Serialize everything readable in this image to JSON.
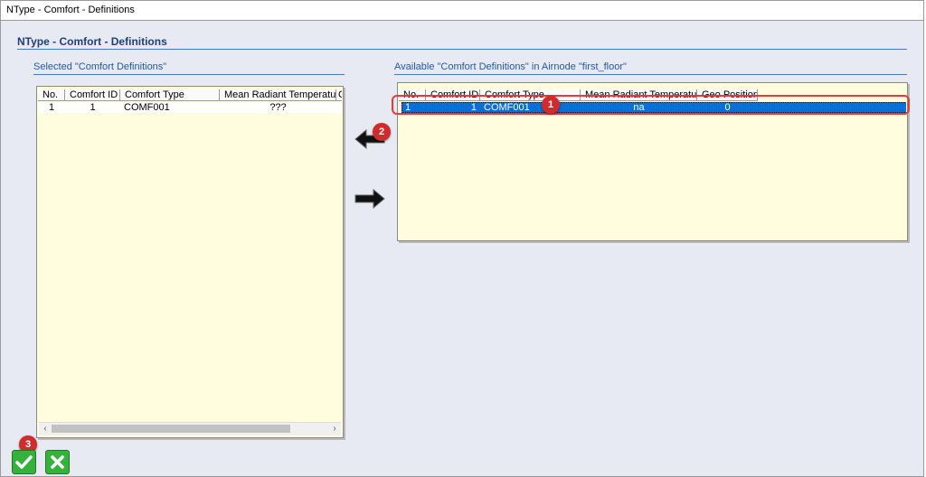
{
  "window": {
    "title": "NType - Comfort - Definitions"
  },
  "header": {
    "title": "NType - Comfort - Definitions"
  },
  "left_panel": {
    "title": "Selected \"Comfort Definitions\"",
    "columns": [
      "No.",
      "Comfort ID",
      "Comfort Type",
      "Mean Radiant Temperature",
      "G"
    ],
    "rows": [
      {
        "no": "1",
        "comfort_id": "1",
        "comfort_type": "COMF001",
        "mrt": "???"
      }
    ]
  },
  "right_panel": {
    "title": "Available \"Comfort Definitions\" in Airnode \"first_floor\"",
    "columns": [
      "No.",
      "Comfort ID",
      "Comfort Type",
      "Mean Radiant Temperature",
      "Geo Position"
    ],
    "rows": [
      {
        "no": "1",
        "comfort_id": "1",
        "comfort_type": "COMF001",
        "mrt": "na",
        "geo": "0"
      }
    ]
  },
  "move": {
    "left_icon": "arrow-left-icon",
    "right_icon": "arrow-right-icon"
  },
  "badges": {
    "one": "1",
    "two": "2",
    "three": "3"
  },
  "footer": {
    "ok_icon": "checkmark-icon",
    "cancel_icon": "close-icon"
  },
  "colors": {
    "accent": "#1e5aa8",
    "selection": "#0a6fd6",
    "grid_bg": "#fffddd",
    "badge": "#d22b2b",
    "ok": "#35b23c"
  }
}
